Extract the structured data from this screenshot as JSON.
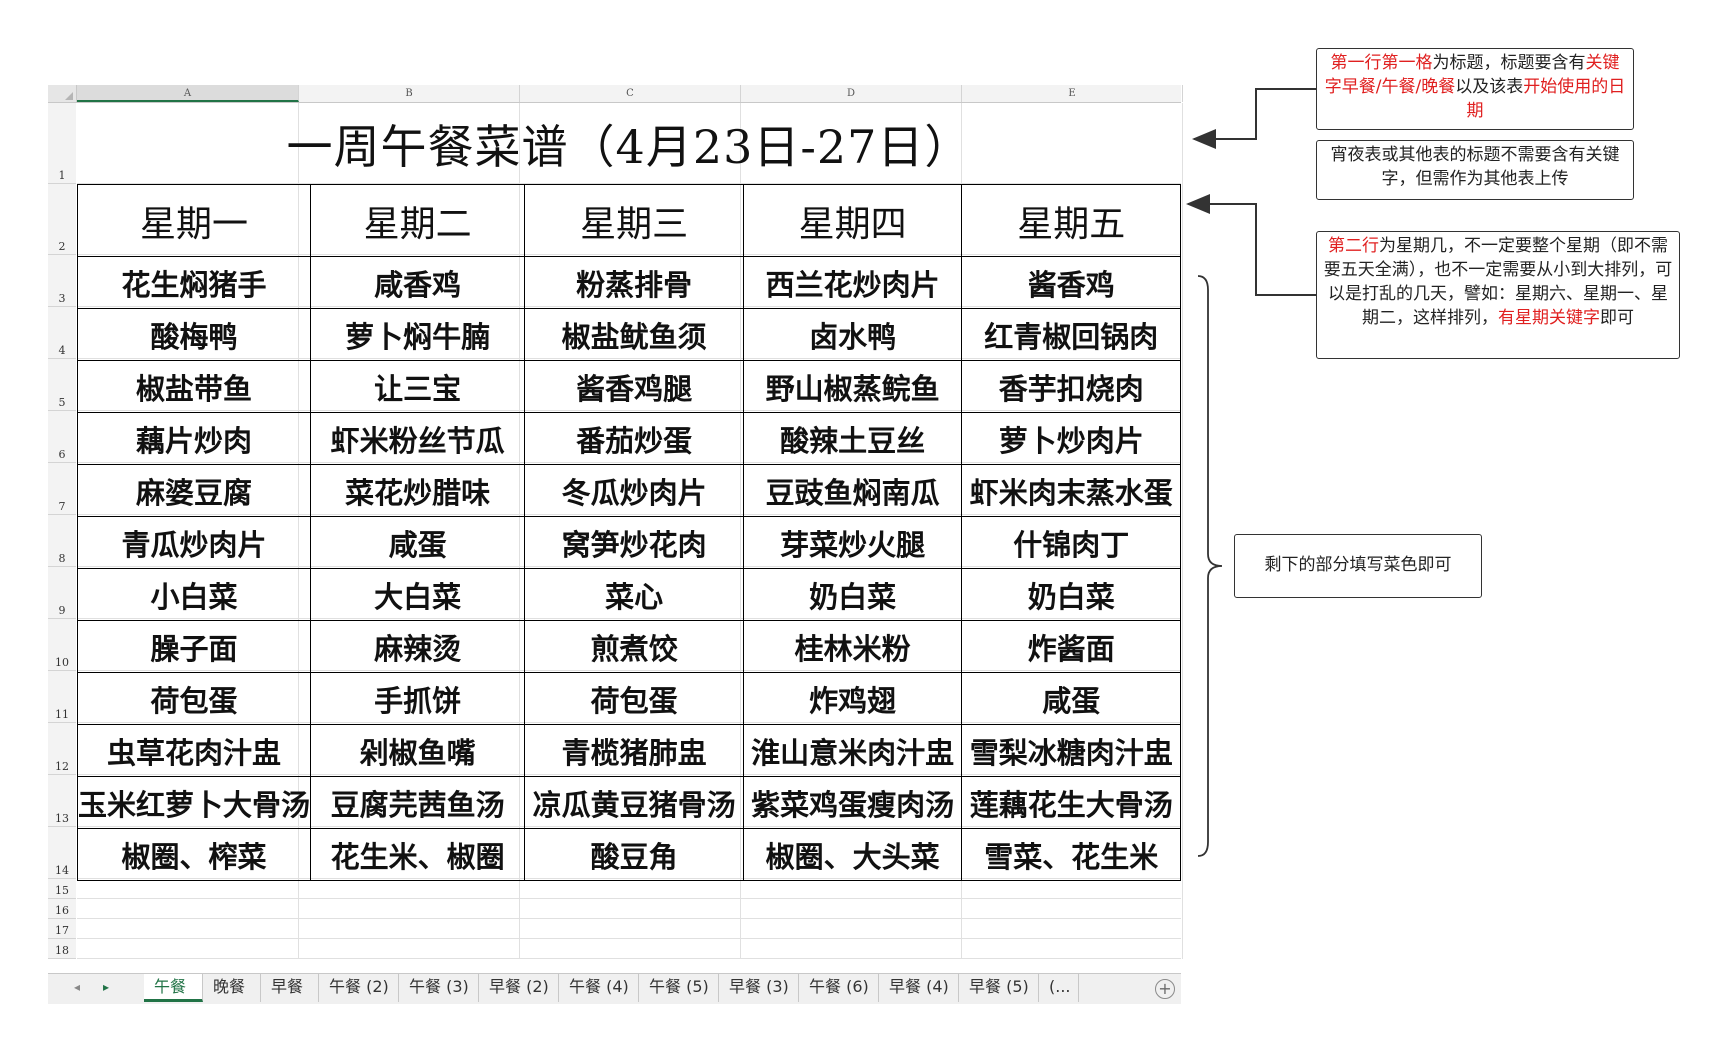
{
  "columns": [
    "A",
    "B",
    "C",
    "D",
    "E"
  ],
  "rows": [
    "1",
    "2",
    "3",
    "4",
    "5",
    "6",
    "7",
    "8",
    "9",
    "10",
    "11",
    "12",
    "13",
    "14",
    "15",
    "16",
    "17",
    "18"
  ],
  "menu": {
    "title": "一周午餐菜谱（4月23日-27日）",
    "days": [
      "星期一",
      "星期二",
      "星期三",
      "星期四",
      "星期五"
    ],
    "dishes": [
      [
        "花生焖猪手",
        "咸香鸡",
        "粉蒸排骨",
        "西兰花炒肉片",
        "酱香鸡"
      ],
      [
        "酸梅鸭",
        "萝卜焖牛腩",
        "椒盐鱿鱼须",
        "卤水鸭",
        "红青椒回锅肉"
      ],
      [
        "椒盐带鱼",
        "让三宝",
        "酱香鸡腿",
        "野山椒蒸鲩鱼",
        "香芋扣烧肉"
      ],
      [
        "藕片炒肉",
        "虾米粉丝节瓜",
        "番茄炒蛋",
        "酸辣土豆丝",
        "萝卜炒肉片"
      ],
      [
        "麻婆豆腐",
        "菜花炒腊味",
        "冬瓜炒肉片",
        "豆豉鱼焖南瓜",
        "虾米肉末蒸水蛋"
      ],
      [
        "青瓜炒肉片",
        "咸蛋",
        "窝笋炒花肉",
        "芽菜炒火腿",
        "什锦肉丁"
      ],
      [
        "小白菜",
        "大白菜",
        "菜心",
        "奶白菜",
        "奶白菜"
      ],
      [
        "臊子面",
        "麻辣烫",
        "煎煮饺",
        "桂林米粉",
        "炸酱面"
      ],
      [
        "荷包蛋",
        "手抓饼",
        "荷包蛋",
        "炸鸡翅",
        "咸蛋"
      ],
      [
        "虫草花肉汁盅",
        "剁椒鱼嘴",
        "青榄猪肺盅",
        "淮山意米肉汁盅",
        "雪梨冰糖肉汁盅"
      ],
      [
        "玉米红萝卜大骨汤",
        "豆腐芫茜鱼汤",
        "凉瓜黄豆猪骨汤",
        "紫菜鸡蛋瘦肉汤",
        "莲藕花生大骨汤"
      ],
      [
        "椒圈、榨菜",
        "花生米、椒圈",
        "酸豆角",
        "椒圈、大头菜",
        "雪菜、花生米"
      ]
    ]
  },
  "tabs": [
    "午餐",
    "晚餐",
    "早餐",
    "午餐 (2)",
    "午餐 (3)",
    "早餐 (2)",
    "午餐 (4)",
    "午餐 (5)",
    "早餐 (3)",
    "午餐 (6)",
    "早餐 (4)",
    "早餐 (5)",
    "(..."
  ],
  "active_tab": "午餐",
  "nav": {
    "prev": "◂",
    "next": "▸",
    "add": "+"
  },
  "notes": {
    "note1": {
      "p1": "第一行第一格",
      "p2": "为标题，标题要含有",
      "p3": "关键字早餐/午餐/晚餐",
      "p4": "以及该表",
      "p5": "开始使用的日期"
    },
    "note2": {
      "text": "宵夜表或其他表的标题不需要含有关键字，但需作为其他表上传"
    },
    "note3": {
      "p1": "第二行",
      "p2": "为星期几，不一定要整个星期（即不需要五天全满），也不一定需要从小到大排列，可以是打乱的几天，譬如：星期六、星期一、星期二，这样排列，",
      "p3": "有星期关键字",
      "p4": "即可"
    },
    "note4": {
      "text": "剩下的部分填写菜色即可"
    }
  },
  "colors": {
    "excel_green": "#217346",
    "annotation_red": "#e02020"
  }
}
